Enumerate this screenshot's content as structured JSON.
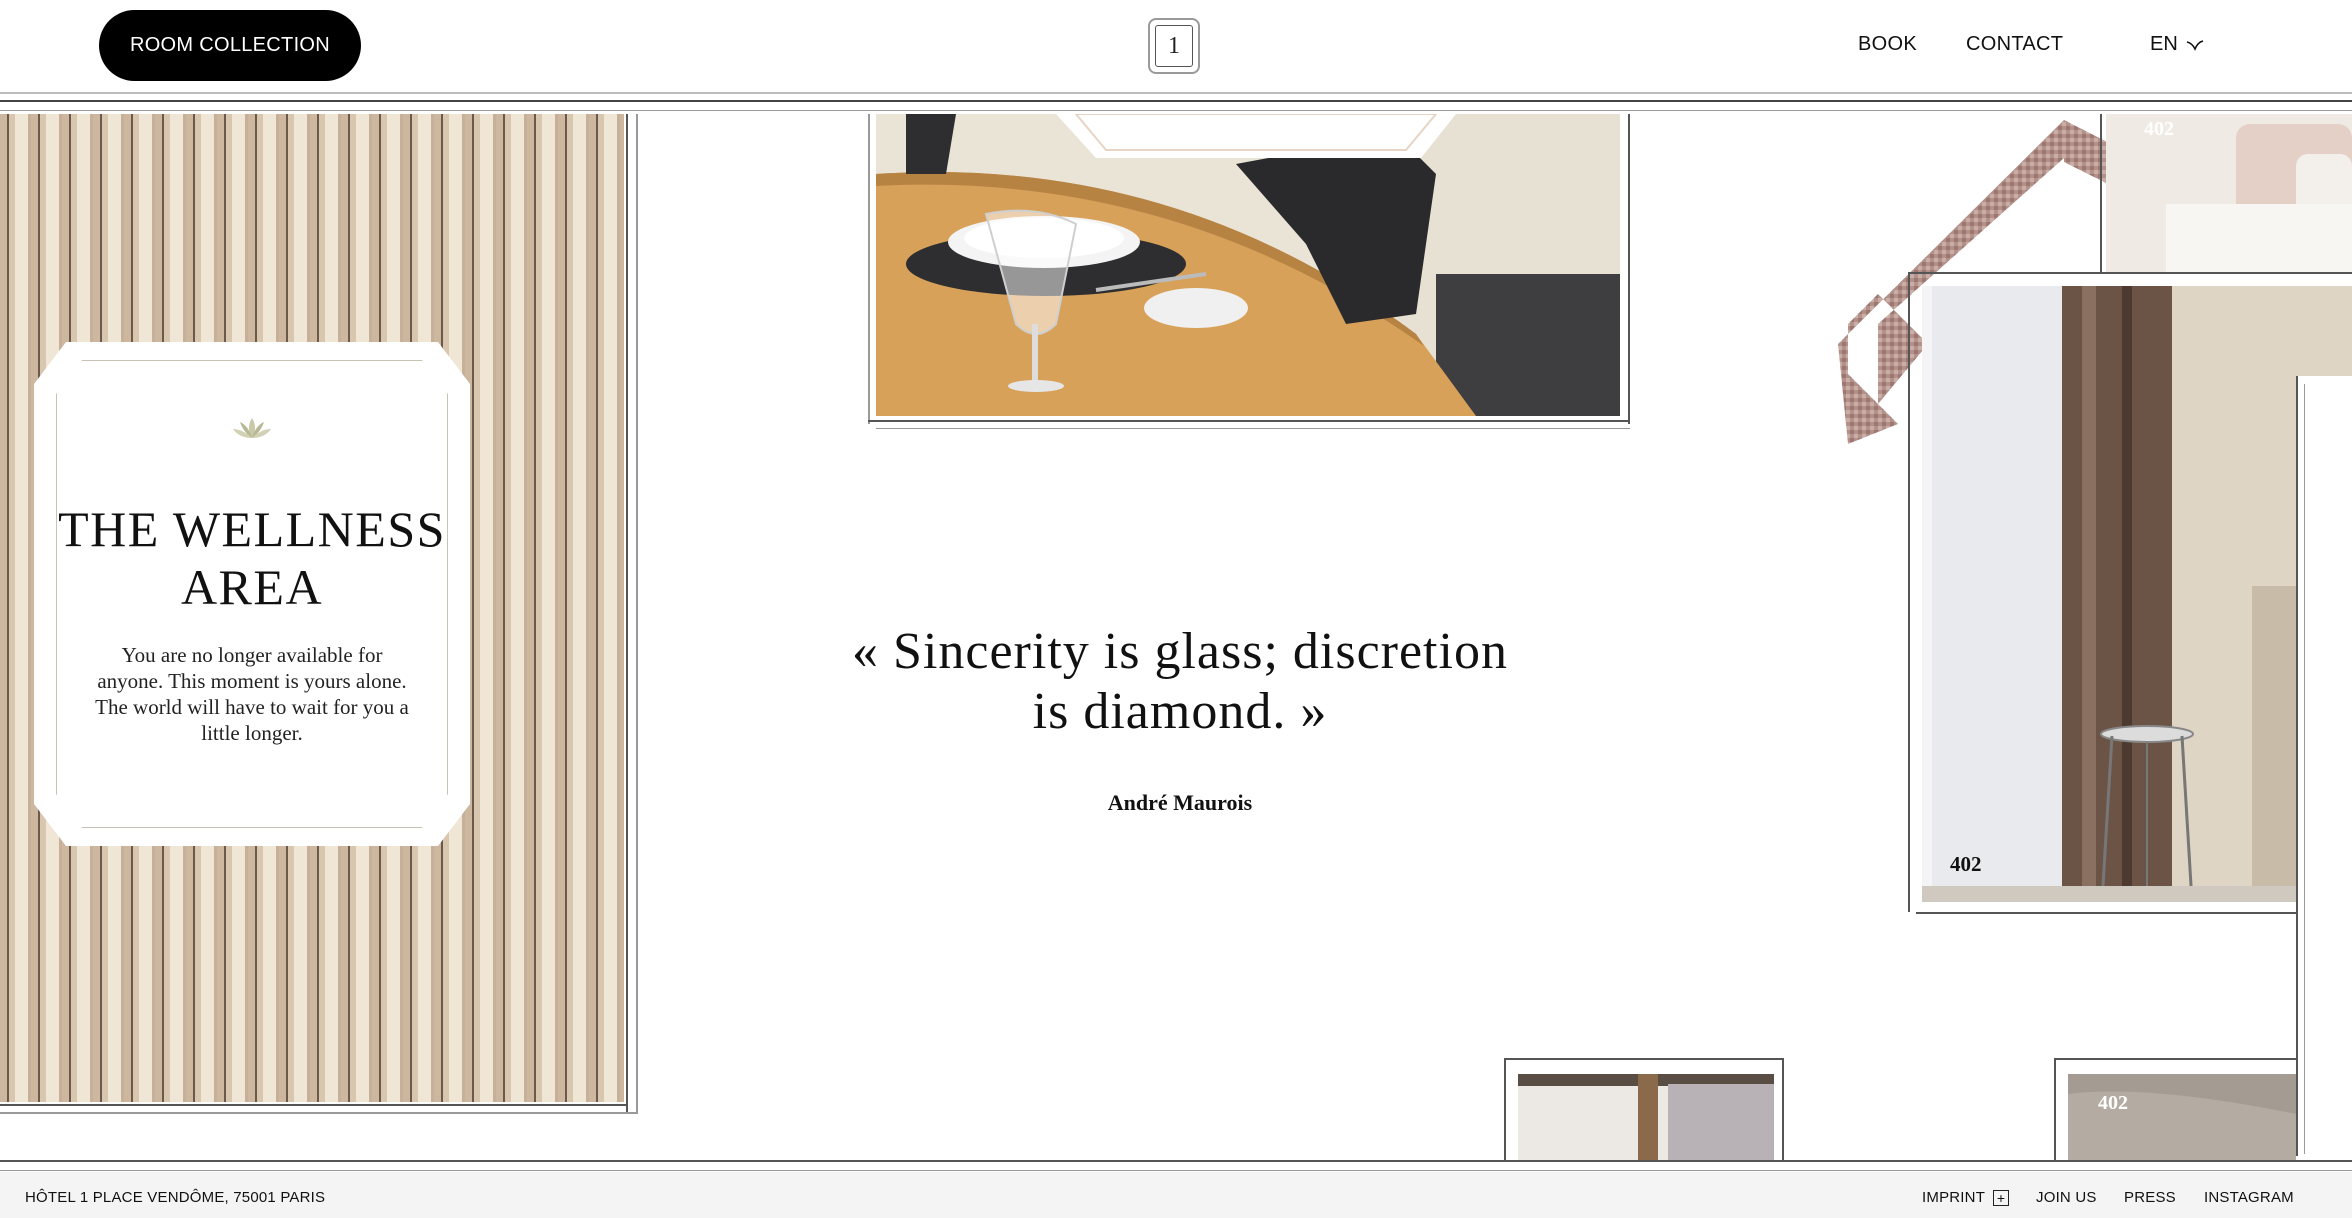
{
  "header": {
    "room_collection_label": "ROOM COLLECTION",
    "logo_text": "1",
    "nav": {
      "book": "BOOK",
      "contact": "CONTACT"
    },
    "language": "EN"
  },
  "wellness": {
    "title": "THE WELLNESS AREA",
    "text": "You are no longer available for anyone. This moment is yours alone. The world will have to wait for you a little longer."
  },
  "quote": {
    "text": "« Sincerity is glass; discretion is diamond. »",
    "author": "André Maurois"
  },
  "room_numbers": {
    "top_right": "402",
    "main_room": "402",
    "bottom_right": "402"
  },
  "footer": {
    "address": "HÔTEL 1 PLACE VENDÔME, 75001 PARIS",
    "imprint": "IMPRINT",
    "join_us": "JOIN US",
    "press": "PRESS",
    "instagram": "INSTAGRAM"
  },
  "icons": {
    "lotus": "lotus-icon",
    "language_chevron": "chevron-down-icon",
    "imprint_plus": "plus-icon"
  },
  "colors": {
    "button_bg": "#000000",
    "stripe_tan": "#cdb79e",
    "stripe_cream": "#efe6d6",
    "stripe_dark": "#6b5a4c",
    "footer_bg": "#f4f4f4"
  }
}
